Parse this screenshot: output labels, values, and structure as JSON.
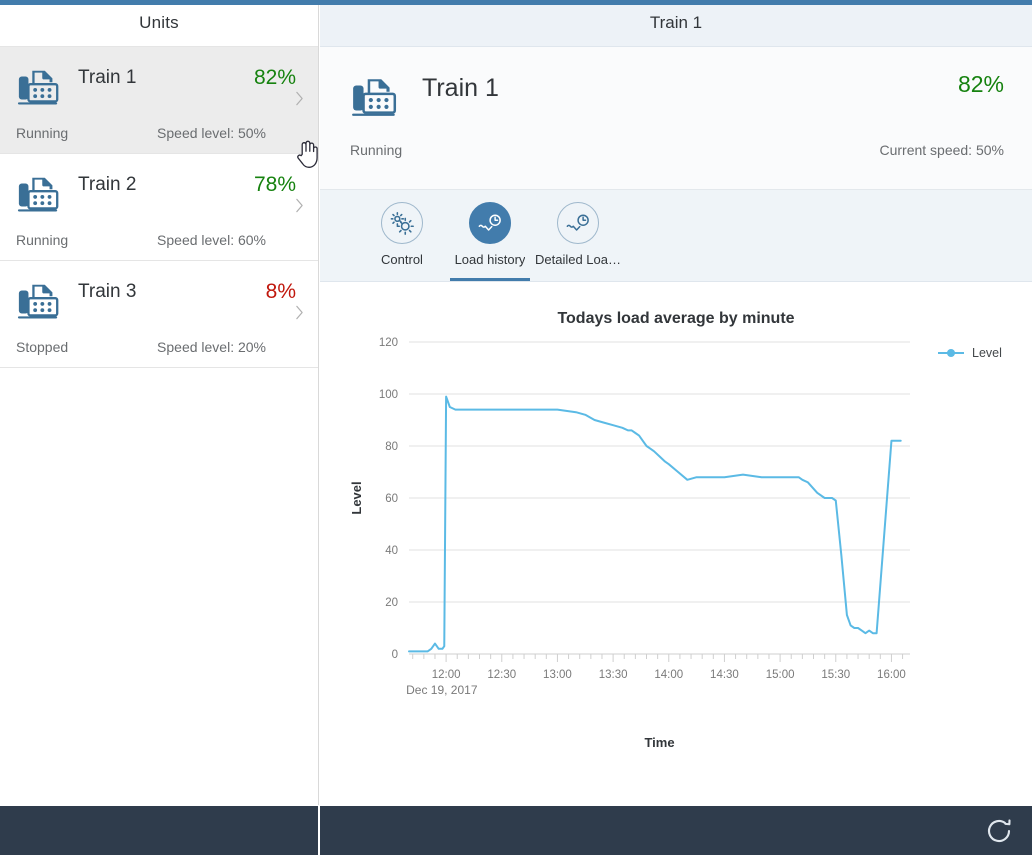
{
  "master": {
    "header_title": "Units",
    "items": [
      {
        "icon": "fax-machine-icon",
        "name": "Train 1",
        "percent": "82%",
        "percent_state": "good",
        "status": "Running",
        "speed": "Speed level: 50%",
        "chevron": "chevron-right-icon",
        "selected": true
      },
      {
        "icon": "fax-machine-icon",
        "name": "Train 2",
        "percent": "78%",
        "percent_state": "good",
        "status": "Running",
        "speed": "Speed level: 60%",
        "chevron": "chevron-right-icon",
        "selected": false
      },
      {
        "icon": "fax-machine-icon",
        "name": "Train 3",
        "percent": "8%",
        "percent_state": "bad",
        "status": "Stopped",
        "speed": "Speed level: 20%",
        "chevron": "chevron-right-icon",
        "selected": false
      }
    ]
  },
  "detail": {
    "header_title": "Train 1",
    "object": {
      "icon": "fax-machine-icon",
      "title": "Train 1",
      "percent": "82%",
      "status": "Running",
      "speed": "Current speed: 50%"
    },
    "tabs": [
      {
        "label": "Control",
        "icon": "gears-icon",
        "active": false
      },
      {
        "label": "Load history",
        "icon": "line-chart-clock-icon",
        "active": true
      },
      {
        "label": "Detailed Loa…",
        "icon": "line-chart-clock-icon",
        "active": false
      }
    ]
  },
  "footer": {
    "refresh_icon": "refresh-icon"
  },
  "colors": {
    "accent": "#427cac",
    "positive": "#16820f",
    "negative": "#c0170c",
    "chart_line": "#5bbae5",
    "footer": "#2f3c4c",
    "selected_row": "#ececec"
  },
  "chart_data": {
    "type": "line",
    "title": "Todays load average by minute",
    "xlabel": "Time",
    "ylabel": "Level",
    "date_label": "Dec 19, 2017",
    "ylim": [
      0,
      120
    ],
    "yticks": [
      0,
      20,
      40,
      60,
      80,
      100,
      120
    ],
    "xticks": [
      "12:00",
      "12:30",
      "13:00",
      "13:30",
      "14:00",
      "14:30",
      "15:00",
      "15:30",
      "16:00"
    ],
    "xlim": [
      "11:40",
      "16:10"
    ],
    "grid": "horizontal",
    "legend": {
      "position": "right",
      "entries": [
        "Level"
      ]
    },
    "series": [
      {
        "name": "Level",
        "color": "#5bbae5",
        "x": [
          "11:40",
          "11:45",
          "11:50",
          "11:52",
          "11:54",
          "11:56",
          "11:58",
          "11:59",
          "12:00",
          "12:02",
          "12:05",
          "12:20",
          "12:40",
          "13:00",
          "13:10",
          "13:15",
          "13:20",
          "13:25",
          "13:30",
          "13:35",
          "13:38",
          "13:40",
          "13:42",
          "13:44",
          "13:46",
          "13:48",
          "13:50",
          "13:52",
          "13:55",
          "13:58",
          "14:00",
          "14:05",
          "14:10",
          "14:15",
          "14:20",
          "14:30",
          "14:40",
          "14:50",
          "15:00",
          "15:05",
          "15:08",
          "15:10",
          "15:12",
          "15:15",
          "15:20",
          "15:24",
          "15:26",
          "15:28",
          "15:30",
          "15:33",
          "15:36",
          "15:38",
          "15:40",
          "15:42",
          "15:44",
          "15:46",
          "15:48",
          "15:50",
          "15:52",
          "16:00",
          "16:05"
        ],
        "y": [
          1,
          1,
          1,
          2,
          4,
          2,
          2,
          3,
          99,
          95,
          94,
          94,
          94,
          94,
          93,
          92,
          90,
          89,
          88,
          87,
          86,
          86,
          85,
          84,
          82,
          80,
          79,
          78,
          76,
          74,
          73,
          70,
          67,
          68,
          68,
          68,
          69,
          68,
          68,
          68,
          68,
          68,
          67,
          66,
          62,
          60,
          60,
          60,
          59,
          38,
          15,
          11,
          10,
          10,
          9,
          8,
          9,
          8,
          8,
          82,
          82
        ]
      }
    ]
  }
}
